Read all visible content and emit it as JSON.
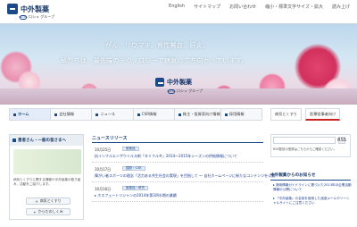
{
  "header": {
    "logo_text": "中外製薬",
    "roche_badge": "Roche",
    "roche_text": "ロシュ グループ",
    "links": [
      "English",
      "サイトマップ",
      "お問い合わせ",
      "縮小・標準文字サイズ・拡大",
      "読み上げ"
    ]
  },
  "hero": {
    "line1": "がん、リウマチ、腎性貧血、肝炎。",
    "line2": "私たちは、最先端のテクノロジーで病気に立ち向かっています。",
    "logo_text": "中外製薬",
    "roche_badge": "Roche",
    "roche_text": "ロシュ グループ"
  },
  "mainnav": {
    "items": [
      "ホーム",
      "会社情報",
      "ニュース",
      "CSR情報",
      "株主・投資家向け情報",
      "採用情報"
    ]
  },
  "right_buttons": [
    "病気とくすり",
    "医療従事者向け"
  ],
  "left_panel": {
    "title": "患者さん・一般の皆さまへ",
    "desc": "病気とくすりに関する情報や中外製薬の取り組み、活動をご紹介します。",
    "buttons": [
      "病気とくすり",
      "からだのしくみ"
    ]
  },
  "news": {
    "title": "ニュースリリース",
    "items": [
      {
        "date": "10月25日",
        "category": "医薬品",
        "text": "抗インフルエンザウイルス剤「タミフル®」2014～2015年シーズンの供給情報について"
      },
      {
        "date": "10月17日",
        "category": "国際・CSR",
        "text": "障がい者スポーツの理念「活力ある共生社会の実現」を目指して ～ 自社ホームページに新たなコンテンツを公開"
      },
      {
        "date": "10月16日",
        "category": "医薬品・研究",
        "text": "ホスフェートリジャンの2014年第3四半期の業績",
        "arrow": "▸"
      }
    ]
  },
  "rss": {
    "note": "RSS配信の登録はこちらからご確認ください。",
    "icon": "RSS"
  },
  "right_section": {
    "title": "中外製薬からのお知らせ",
    "items": [
      "▸ 適用情報ガイドラインに基づいた2013年の企業活動情報の公開について",
      "▸ 「中外製薬」の名前を使用した迷惑メールやソーシャルサイトにご注意ください"
    ]
  },
  "colors": {
    "brand_blue": "#1a4a8a",
    "news_link": "#1a3a8a"
  }
}
